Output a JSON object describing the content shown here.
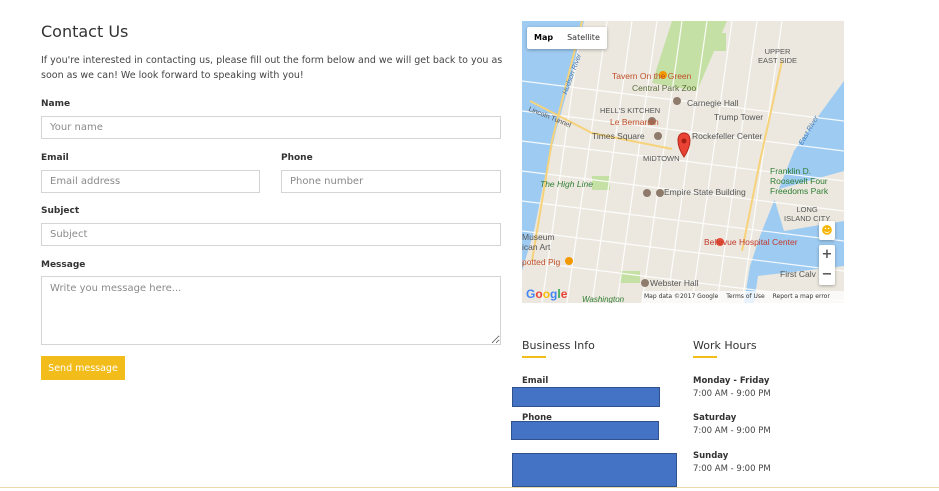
{
  "contact": {
    "title": "Contact Us",
    "intro": "If you're interested in contacting us, please fill out the form below and we will get back to you as soon as we can! We look forward to speaking with you!",
    "name_label": "Name",
    "name_placeholder": "Your name",
    "email_label": "Email",
    "email_placeholder": "Email address",
    "phone_label": "Phone",
    "phone_placeholder": "Phone number",
    "subject_label": "Subject",
    "subject_placeholder": "Subject",
    "message_label": "Message",
    "message_placeholder": "Write you message here...",
    "send_label": "Send message"
  },
  "map": {
    "tab_map": "Map",
    "tab_satellite": "Satellite",
    "zoom_in": "+",
    "zoom_out": "−",
    "footer_data": "Map data ©2017 Google",
    "footer_terms": "Terms of Use",
    "footer_report": "Report a map error",
    "google": "Google",
    "labels": {
      "upper_east_side": "UPPER\nEAST SIDE",
      "tavern": "Tavern On the Green",
      "central_park_zoo": "Central Park Zoo",
      "hells_kitchen": "HELL'S KITCHEN",
      "carnegie_hall": "Carnegie Hall",
      "le_bernardin": "Le Bernardin",
      "trump_tower": "Trump Tower",
      "times_square": "Times Square",
      "rockefeller": "Rockefeller Center",
      "midtown": "MIDTOWN",
      "high_line": "The High Line",
      "empire_state": "Empire State Building",
      "franklin": "Franklin D. Roosevelt Four Freedoms Park",
      "long_island_city": "LONG\nISLAND CITY",
      "museum": "Museum\nican Art",
      "bellevue": "Bellevue Hospital Center",
      "spotted_pig": "potted Pig",
      "webster_hall": "Webster Hall",
      "first_calv": "First Calv",
      "washington": "Washington",
      "lincoln_tunnel": "Lincoln Tunnel",
      "hudson_river": "Hudson River",
      "east_river": "East River"
    }
  },
  "business": {
    "title": "Business Info",
    "email_label": "Email",
    "phone_label": "Phone"
  },
  "hours": {
    "title": "Work Hours",
    "weekday_label": "Monday - Friday",
    "weekday_time": "7:00 AM - 9:00 PM",
    "saturday_label": "Saturday",
    "saturday_time": "7:00 AM - 9:00 PM",
    "sunday_label": "Sunday",
    "sunday_time": "7:00 AM - 9:00 PM"
  },
  "colors": {
    "accent": "#f2bc1b",
    "redaction": "#4472c4",
    "water": "#9ecbf2",
    "park": "#c5e0a5"
  }
}
